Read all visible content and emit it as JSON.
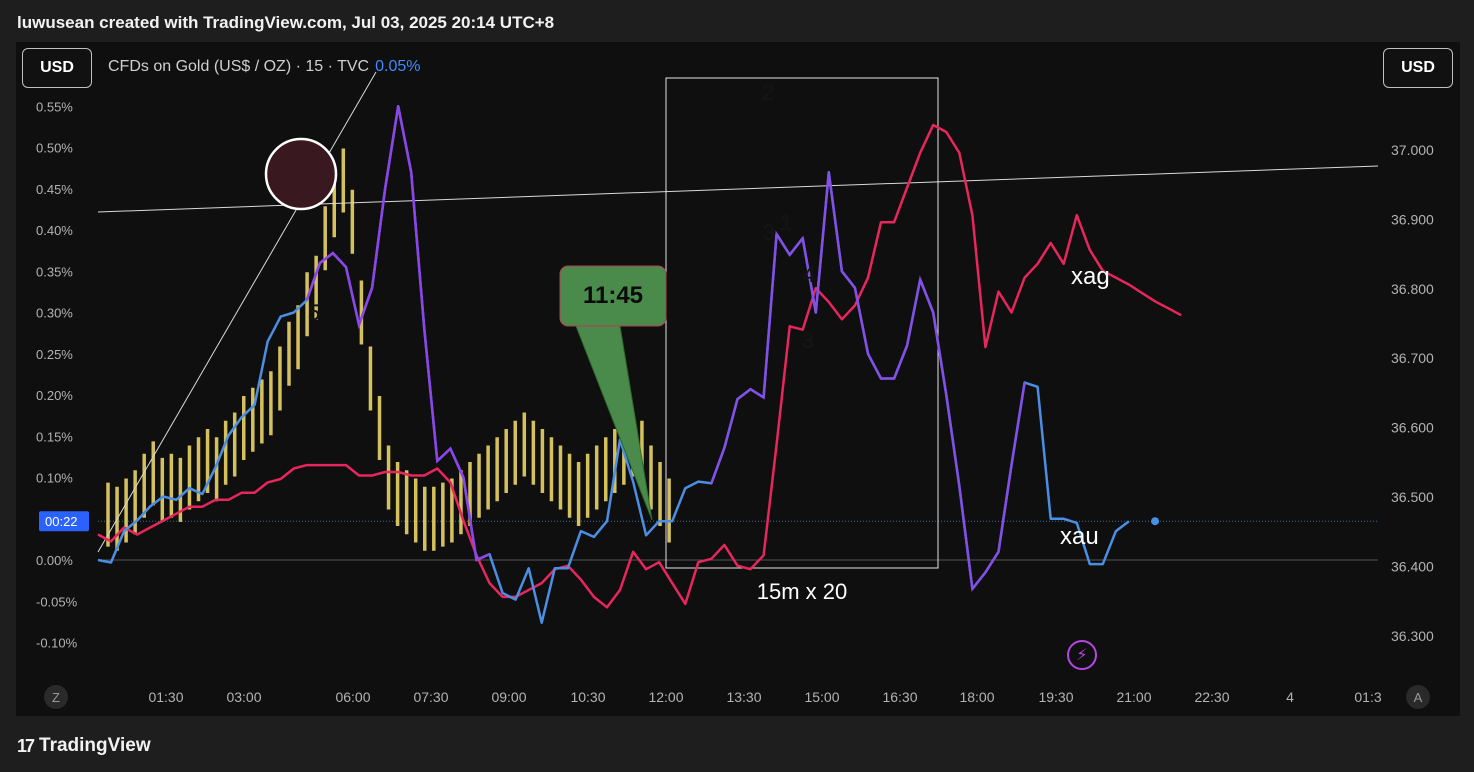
{
  "header": {
    "title": "luwusean created with TradingView.com, Jul 03, 2025 20:14 UTC+8"
  },
  "toolbar": {
    "left_currency": "USD",
    "right_currency": "USD",
    "symbol": "CFDs on Gold (US$ / OZ) · 15 · TVC",
    "change": "0.05%"
  },
  "scale_buttons": {
    "left": "Z",
    "right": "A"
  },
  "footer": {
    "brand": "TradingView"
  },
  "colors": {
    "background": "#0f0f0f",
    "volume_bar": "#f7e06b",
    "xag_line": "#e8265e",
    "xau_line": "#4a8fe3",
    "purple_line": "#8e44e8",
    "callout": "#4a8a4a",
    "accent_blue": "#3d8bff"
  },
  "chart_data": {
    "type": "line",
    "time_axis": [
      "01:30",
      "03:00",
      "06:00",
      "07:30",
      "09:00",
      "10:30",
      "12:00",
      "13:30",
      "15:00",
      "16:30",
      "18:00",
      "19:30",
      "21:00",
      "22:30",
      "4",
      "01:3"
    ],
    "left_axis": {
      "unit": "%",
      "ticks": [
        "0.55%",
        "0.50%",
        "0.45%",
        "0.40%",
        "0.35%",
        "0.30%",
        "0.25%",
        "0.20%",
        "0.15%",
        "0.10%",
        "0.00%",
        "-0.05%",
        "-0.10%"
      ],
      "range": [
        -0.12,
        0.58
      ]
    },
    "right_axis": {
      "ticks": [
        "37.000",
        "36.900",
        "36.800",
        "36.700",
        "36.600",
        "36.500",
        "36.400",
        "36.300"
      ],
      "range": [
        36.26,
        37.04
      ]
    },
    "current_marker": {
      "label": "00:22",
      "value": 0.047
    },
    "series": [
      {
        "name": "xag",
        "axis": "right",
        "t": [
          0.0,
          0.25,
          0.5,
          0.75,
          1.0,
          1.25,
          1.5,
          1.75,
          2.0,
          2.25,
          2.5,
          2.75,
          3.0,
          3.25,
          3.5,
          3.75,
          4.0,
          4.25,
          4.5,
          4.75,
          5.0,
          5.25,
          5.5,
          5.75,
          6.0,
          6.25,
          6.5,
          6.75,
          7.0,
          7.25,
          7.5,
          7.75,
          8.0,
          8.25,
          8.5,
          8.75,
          9.0,
          9.25,
          9.5,
          9.75,
          10.0,
          10.25,
          10.5,
          10.75,
          11.0,
          11.25,
          11.5,
          11.75,
          12.0,
          12.25,
          12.5,
          12.75,
          13.0,
          13.25,
          13.5,
          13.75,
          14.0,
          14.25,
          14.5,
          14.75,
          15.0,
          15.25,
          15.5,
          15.75,
          16.0,
          16.25,
          16.5,
          16.75,
          17.0,
          17.25,
          17.5,
          17.75,
          18.0,
          18.25,
          18.5,
          18.75,
          19.0,
          19.25,
          19.5,
          19.75,
          20.0,
          20.25,
          20.5,
          20.75
        ],
        "values": [
          36.446,
          36.436,
          36.456,
          36.446,
          36.456,
          36.466,
          36.476,
          36.486,
          36.486,
          36.496,
          36.496,
          36.506,
          36.506,
          36.521,
          36.526,
          36.541,
          36.546,
          36.546,
          36.546,
          36.546,
          36.531,
          36.531,
          36.536,
          36.536,
          36.531,
          36.531,
          36.541,
          36.521,
          36.466,
          36.416,
          36.376,
          36.356,
          36.356,
          36.366,
          36.376,
          36.396,
          36.401,
          36.381,
          36.356,
          36.341,
          36.366,
          36.421,
          36.396,
          36.406,
          36.376,
          36.346,
          36.406,
          36.411,
          36.431,
          36.401,
          36.396,
          36.416,
          36.576,
          36.746,
          36.741,
          36.801,
          36.781,
          36.756,
          36.776,
          36.816,
          36.896,
          36.896,
          36.946,
          36.996,
          37.036,
          37.026,
          36.996,
          36.906,
          36.716,
          36.796,
          36.766,
          36.816,
          36.836,
          36.866,
          36.836,
          36.906,
          36.856,
          36.826,
          36.816,
          36.806,
          36.794,
          36.782,
          36.772,
          36.762
        ]
      },
      {
        "name": "xau",
        "axis": "left",
        "t": [
          0.0,
          0.25,
          0.5,
          0.75,
          1.0,
          1.25,
          1.5,
          1.75,
          2.0,
          2.25,
          2.5,
          2.75,
          3.0,
          3.25,
          3.5,
          3.75,
          4.0,
          4.25,
          4.5,
          4.75,
          5.0,
          5.25,
          5.5,
          5.75,
          6.0,
          6.25,
          6.5,
          6.75,
          7.0,
          7.25,
          7.5,
          7.75,
          8.0,
          8.25,
          8.5,
          8.75,
          9.0,
          9.25,
          9.5,
          9.75,
          10.0,
          10.25,
          10.5,
          10.75,
          11.0,
          11.25,
          11.5,
          11.75,
          12.0,
          12.25,
          12.5,
          12.75,
          13.0,
          13.25,
          13.5,
          13.75,
          14.0,
          14.25,
          14.5,
          14.75,
          15.0,
          15.25,
          15.5,
          15.75,
          16.0,
          16.25,
          16.5,
          16.75,
          17.0,
          17.25,
          17.5,
          17.75,
          18.0,
          18.25,
          18.5,
          18.75,
          19.0,
          19.25,
          19.5,
          19.75,
          20.0,
          20.25
        ],
        "values": [
          0.0,
          -0.003,
          0.035,
          0.048,
          0.065,
          0.077,
          0.073,
          0.087,
          0.08,
          0.112,
          0.151,
          0.173,
          0.188,
          0.265,
          0.295,
          0.3,
          0.315,
          0.36,
          0.372,
          0.355,
          0.285,
          0.33,
          0.45,
          0.55,
          0.47,
          0.28,
          0.12,
          0.135,
          0.1,
          0.0,
          0.007,
          -0.04,
          -0.048,
          -0.01,
          -0.076,
          -0.01,
          -0.01,
          0.035,
          0.028,
          0.047,
          0.146,
          0.095,
          0.03,
          0.047,
          0.047,
          0.087,
          0.095,
          0.093,
          0.136,
          0.195,
          0.207,
          0.197,
          0.395,
          0.37,
          0.39,
          0.3,
          0.47,
          0.35,
          0.33,
          0.25,
          0.22,
          0.22,
          0.26,
          0.34,
          0.3,
          0.2,
          0.09,
          -0.035,
          -0.015,
          0.01,
          0.115,
          0.215,
          0.21,
          0.05,
          0.05,
          0.045,
          -0.005,
          -0.005,
          0.035,
          0.047
        ]
      }
    ],
    "volume_bars": [
      0.055,
      0.05,
      0.06,
      0.07,
      0.09,
      0.105,
      0.085,
      0.09,
      0.085,
      0.1,
      0.11,
      0.12,
      0.11,
      0.13,
      0.14,
      0.16,
      0.17,
      0.18,
      0.19,
      0.22,
      0.25,
      0.27,
      0.31,
      0.33,
      0.39,
      0.43,
      0.46,
      0.41,
      0.3,
      0.22,
      0.16,
      0.1,
      0.08,
      0.07,
      0.06,
      0.05,
      0.05,
      0.055,
      0.06,
      0.07,
      0.08,
      0.09,
      0.1,
      0.11,
      0.12,
      0.13,
      0.14,
      0.13,
      0.12,
      0.11,
      0.1,
      0.09,
      0.08,
      0.09,
      0.1,
      0.11,
      0.12,
      0.13,
      0.14,
      0.13,
      0.1,
      0.08,
      0.06
    ],
    "annotations": {
      "callout_time": "11:45",
      "range_box_label": "15m x 20",
      "wave_labels": [
        "2",
        "3",
        "4",
        "3",
        "5",
        "1"
      ],
      "series_labels": [
        "xag",
        "xau"
      ]
    }
  }
}
